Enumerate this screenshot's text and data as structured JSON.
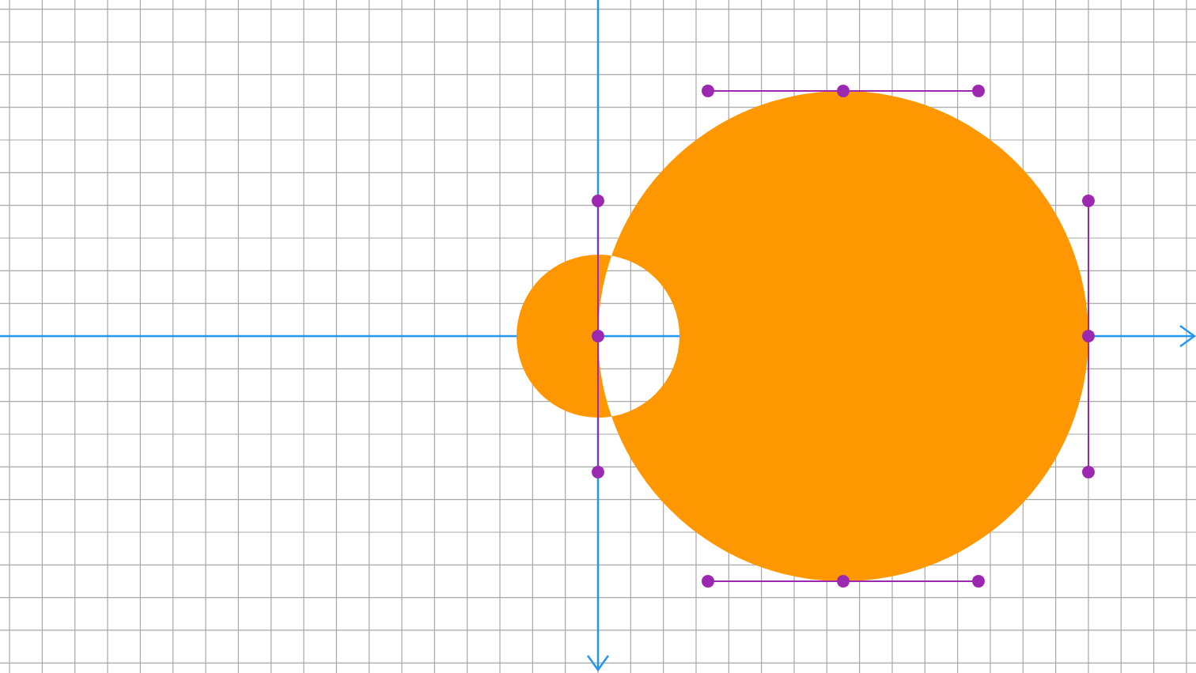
{
  "canvas": {
    "layers": [
      {
        "kind": "grid"
      },
      {
        "kind": "axes"
      },
      {
        "kind": "shape"
      },
      {
        "kind": "control-points"
      }
    ]
  }
}
